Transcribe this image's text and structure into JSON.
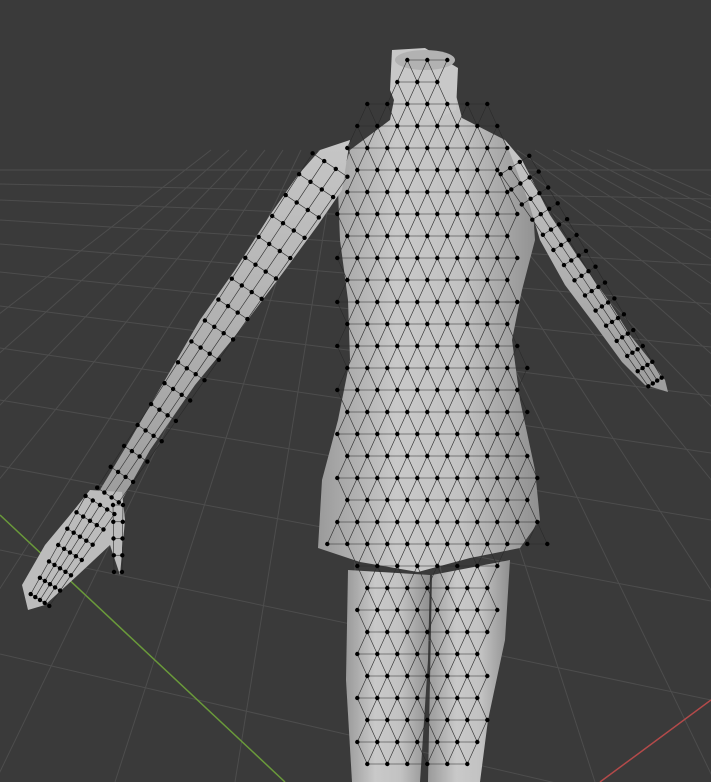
{
  "viewport": {
    "background": "#3a3a3a",
    "grid_color": "#4d4d4d",
    "axis_x_color": "#b34a4a",
    "axis_y_color": "#6a9a3a"
  },
  "mesh": {
    "object": "female-figure-in-dress",
    "mode": "edit-mode-vertices",
    "surface_color": "#bdbdbd",
    "wire_color": "#2a2a2a",
    "vertex_color": "#000000"
  }
}
